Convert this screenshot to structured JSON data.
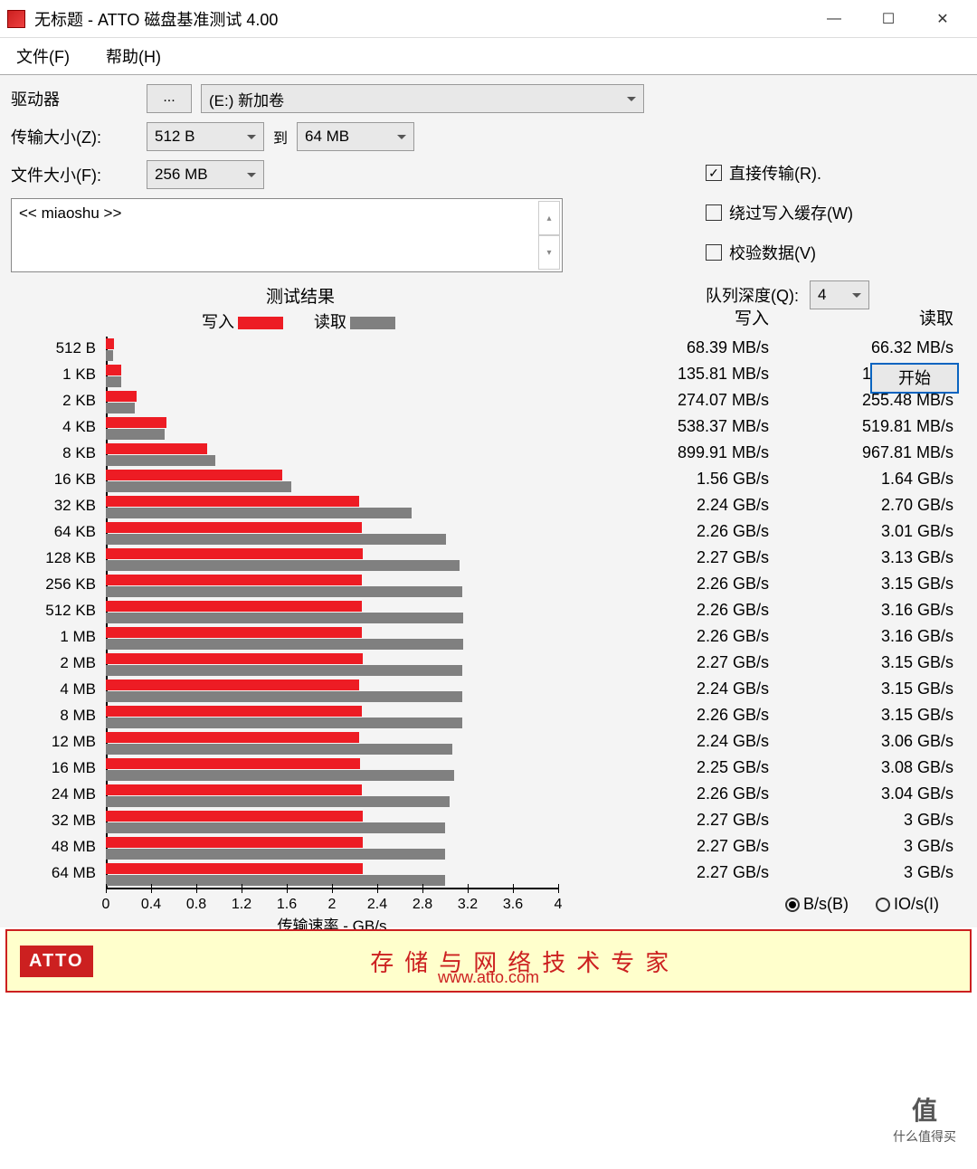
{
  "window": {
    "title": "无标题 - ATTO 磁盘基准测试 4.00",
    "minimize": "—",
    "maximize": "☐",
    "close": "✕"
  },
  "menu": {
    "file": "文件(F)",
    "help": "帮助(H)"
  },
  "form": {
    "drive_label": "驱动器",
    "drive_browse": "...",
    "drive_value": "(E:) 新加卷",
    "transfer_size_label": "传输大小(Z):",
    "transfer_from": "512 B",
    "to_label": "到",
    "transfer_to": "64 MB",
    "file_size_label": "文件大小(F):",
    "file_size": "256 MB"
  },
  "options": {
    "direct_io": "直接传输(R).",
    "direct_io_checked": true,
    "bypass_cache": "绕过写入缓存(W)",
    "bypass_cache_checked": false,
    "verify": "校验数据(V)",
    "verify_checked": false,
    "queue_depth_label": "队列深度(Q):",
    "queue_depth": "4"
  },
  "description": "<< miaoshu >>",
  "start_button": "开始",
  "chart": {
    "title": "测试结果",
    "legend_write": "写入",
    "legend_read": "读取",
    "xlabel": "传输速率 - GB/s",
    "ticks": [
      "0",
      "0.4",
      "0.8",
      "1.2",
      "1.6",
      "2",
      "2.4",
      "2.8",
      "3.2",
      "3.6",
      "4"
    ]
  },
  "data_header": {
    "write": "写入",
    "read": "读取"
  },
  "radio": {
    "bs": "B/s(B)",
    "ios": "IO/s(I)"
  },
  "banner": {
    "logo": "ATTO",
    "slogan": "存储与网络技术专家",
    "url": "www.atto.com"
  },
  "watermark": {
    "top": "值",
    "bottom": "什么值得买"
  },
  "chart_data": {
    "type": "bar",
    "title": "测试结果",
    "xlabel": "传输速率 - GB/s",
    "xlim": [
      0,
      4
    ],
    "categories": [
      "512 B",
      "1 KB",
      "2 KB",
      "4 KB",
      "8 KB",
      "16 KB",
      "32 KB",
      "64 KB",
      "128 KB",
      "256 KB",
      "512 KB",
      "1 MB",
      "2 MB",
      "4 MB",
      "8 MB",
      "12 MB",
      "16 MB",
      "24 MB",
      "32 MB",
      "48 MB",
      "64 MB"
    ],
    "series": [
      {
        "name": "写入",
        "unit": "MB/s or GB/s as labeled",
        "values_gb_s": [
          0.06839,
          0.13581,
          0.27407,
          0.53837,
          0.89991,
          1.56,
          2.24,
          2.26,
          2.27,
          2.26,
          2.26,
          2.26,
          2.27,
          2.24,
          2.26,
          2.24,
          2.25,
          2.26,
          2.27,
          2.27,
          2.27
        ],
        "display": [
          "68.39 MB/s",
          "135.81 MB/s",
          "274.07 MB/s",
          "538.37 MB/s",
          "899.91 MB/s",
          "1.56 GB/s",
          "2.24 GB/s",
          "2.26 GB/s",
          "2.27 GB/s",
          "2.26 GB/s",
          "2.26 GB/s",
          "2.26 GB/s",
          "2.27 GB/s",
          "2.24 GB/s",
          "2.26 GB/s",
          "2.24 GB/s",
          "2.25 GB/s",
          "2.26 GB/s",
          "2.27 GB/s",
          "2.27 GB/s",
          "2.27 GB/s"
        ]
      },
      {
        "name": "读取",
        "values_gb_s": [
          0.06632,
          0.13801,
          0.25548,
          0.51981,
          0.96781,
          1.64,
          2.7,
          3.01,
          3.13,
          3.15,
          3.16,
          3.16,
          3.15,
          3.15,
          3.15,
          3.06,
          3.08,
          3.04,
          3.0,
          3.0,
          3.0
        ],
        "display": [
          "66.32 MB/s",
          "138.01 MB/s",
          "255.48 MB/s",
          "519.81 MB/s",
          "967.81 MB/s",
          "1.64 GB/s",
          "2.70 GB/s",
          "3.01 GB/s",
          "3.13 GB/s",
          "3.15 GB/s",
          "3.16 GB/s",
          "3.16 GB/s",
          "3.15 GB/s",
          "3.15 GB/s",
          "3.15 GB/s",
          "3.06 GB/s",
          "3.08 GB/s",
          "3.04 GB/s",
          "3 GB/s",
          "3 GB/s",
          "3 GB/s"
        ]
      }
    ]
  }
}
